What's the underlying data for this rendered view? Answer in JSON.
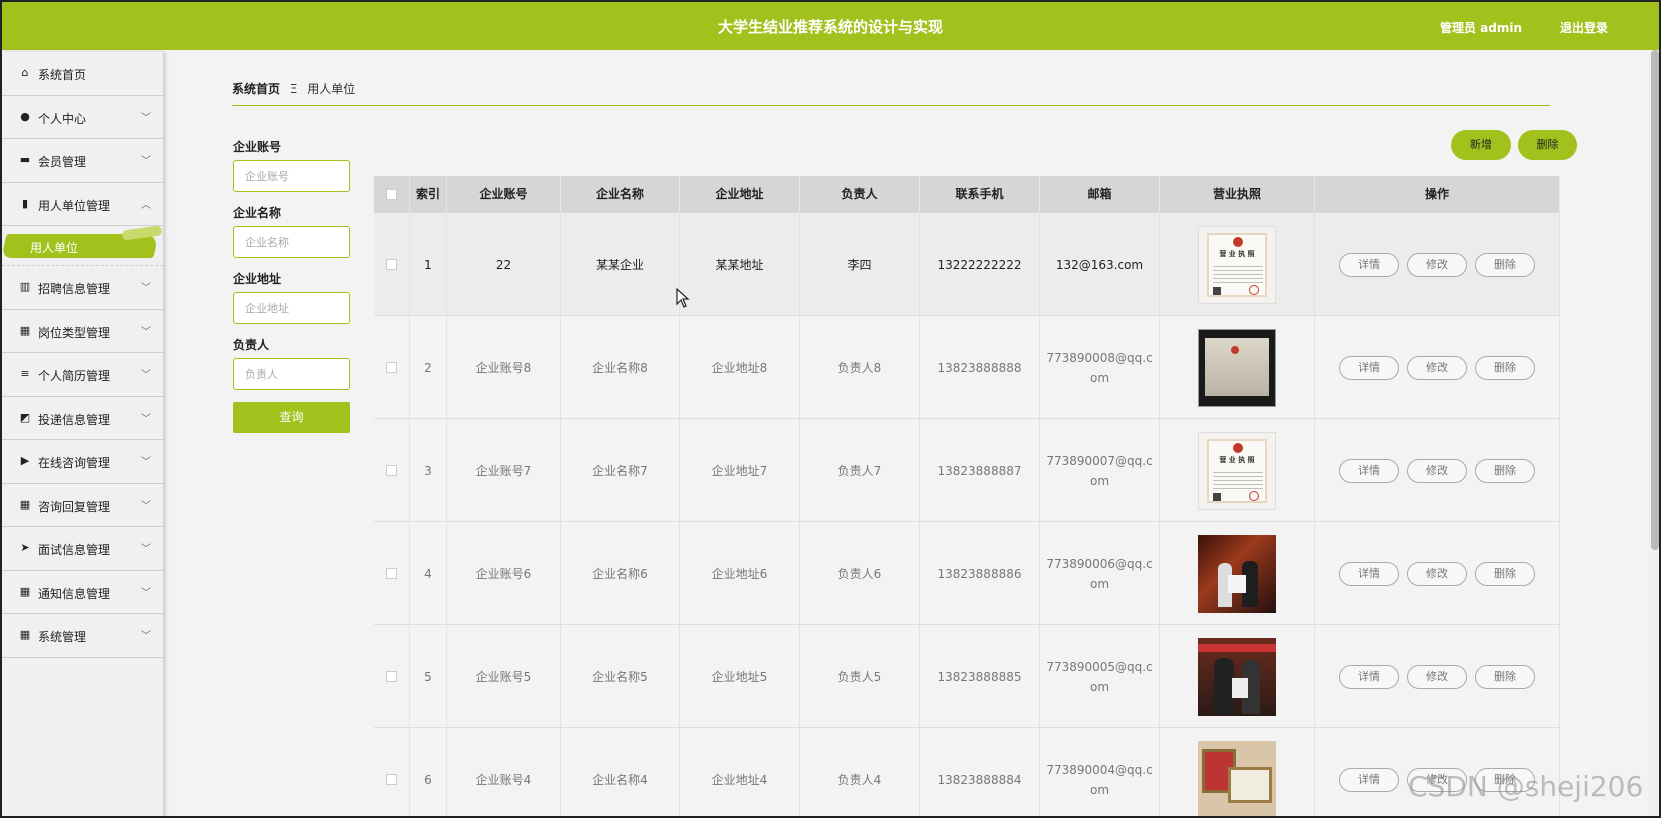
{
  "header": {
    "title": "大学生结业推荐系统的设计与实现",
    "admin_label": "管理员 admin",
    "logout_label": "退出登录"
  },
  "sidebar": {
    "items": [
      {
        "label": "系统首页",
        "icon": "home-icon",
        "glyph": "⌂",
        "chevron": ""
      },
      {
        "label": "个人中心",
        "icon": "user-icon",
        "glyph": "●",
        "chevron": "﹀"
      },
      {
        "label": "会员管理",
        "icon": "message-icon",
        "glyph": "▬",
        "chevron": "﹀"
      },
      {
        "label": "用人单位管理",
        "icon": "clipboard-icon",
        "glyph": "▮",
        "chevron": "︿"
      },
      {
        "label": "招聘信息管理",
        "icon": "bar-chart-icon",
        "glyph": "▥",
        "chevron": "﹀"
      },
      {
        "label": "岗位类型管理",
        "icon": "grid-icon",
        "glyph": "▦",
        "chevron": "﹀"
      },
      {
        "label": "个人简历管理",
        "icon": "sliders-icon",
        "glyph": "≡",
        "chevron": "﹀"
      },
      {
        "label": "投递信息管理",
        "icon": "line-chart-icon",
        "glyph": "◩",
        "chevron": "﹀"
      },
      {
        "label": "在线咨询管理",
        "icon": "video-icon",
        "glyph": "▶",
        "chevron": "﹀"
      },
      {
        "label": "咨询回复管理",
        "icon": "grid-icon",
        "glyph": "▦",
        "chevron": "﹀"
      },
      {
        "label": "面试信息管理",
        "icon": "send-icon",
        "glyph": "➤",
        "chevron": "﹀"
      },
      {
        "label": "通知信息管理",
        "icon": "grid-icon",
        "glyph": "▦",
        "chevron": "﹀"
      },
      {
        "label": "系统管理",
        "icon": "grid-icon",
        "glyph": "▦",
        "chevron": "﹀"
      }
    ],
    "active_sub": "用人单位"
  },
  "breadcrumb": {
    "home": "系统首页",
    "separator": "Ξ",
    "current": "用人单位"
  },
  "search": {
    "fields": [
      {
        "label": "企业账号",
        "placeholder": "企业账号"
      },
      {
        "label": "企业名称",
        "placeholder": "企业名称"
      },
      {
        "label": "企业地址",
        "placeholder": "企业地址"
      },
      {
        "label": "负责人",
        "placeholder": "负责人"
      }
    ],
    "query_label": "查询"
  },
  "actions": {
    "add_label": "新增",
    "delete_label": "删除"
  },
  "table": {
    "columns": [
      "索引",
      "企业账号",
      "企业名称",
      "企业地址",
      "负责人",
      "联系手机",
      "邮箱",
      "营业执照",
      "操作"
    ],
    "ops": {
      "detail": "详情",
      "edit": "修改",
      "delete": "删除"
    },
    "rows": [
      {
        "index": "1",
        "account": "22",
        "name": "某某企业",
        "address": "某某地址",
        "person": "李四",
        "phone": "13222222222",
        "email": "132@163.com",
        "license": "cert"
      },
      {
        "index": "2",
        "account": "企业账号8",
        "name": "企业名称8",
        "address": "企业地址8",
        "person": "负责人8",
        "phone": "13823888888",
        "email": "773890008@qq.com",
        "license": "dark"
      },
      {
        "index": "3",
        "account": "企业账号7",
        "name": "企业名称7",
        "address": "企业地址7",
        "person": "负责人7",
        "phone": "13823888887",
        "email": "773890007@qq.com",
        "license": "cert"
      },
      {
        "index": "4",
        "account": "企业账号6",
        "name": "企业名称6",
        "address": "企业地址6",
        "person": "负责人6",
        "phone": "13823888886",
        "email": "773890006@qq.com",
        "license": "photo1"
      },
      {
        "index": "5",
        "account": "企业账号5",
        "name": "企业名称5",
        "address": "企业地址5",
        "person": "负责人5",
        "phone": "13823888885",
        "email": "773890005@qq.com",
        "license": "photo2"
      },
      {
        "index": "6",
        "account": "企业账号4",
        "name": "企业名称4",
        "address": "企业地址4",
        "person": "负责人4",
        "phone": "13823888884",
        "email": "773890004@qq.com",
        "license": "cert2"
      }
    ]
  },
  "watermark": "CSDN @sheji206",
  "colors": {
    "accent": "#a2c11d",
    "background": "#f3f3f3",
    "header_row": "#d6d6d6"
  }
}
